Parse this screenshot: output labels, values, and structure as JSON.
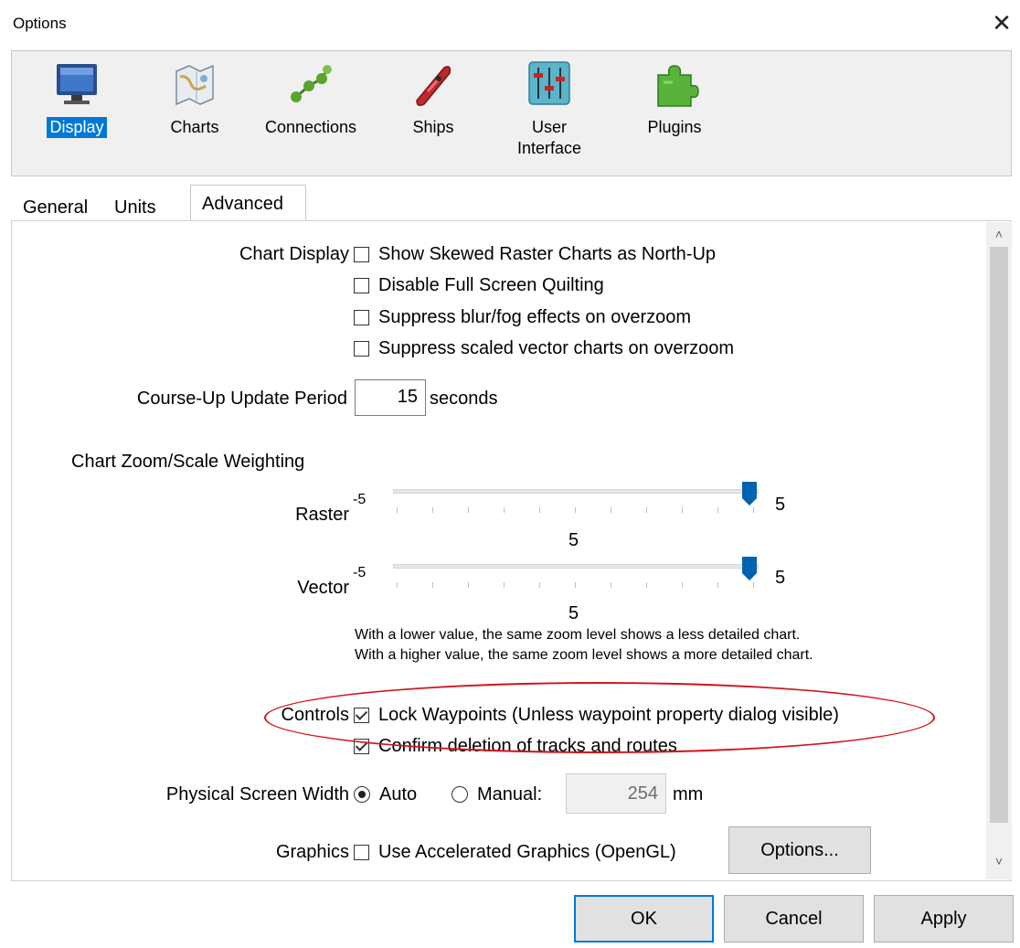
{
  "window": {
    "title": "Options",
    "close_glyph": "✕"
  },
  "toolbar": {
    "items": [
      {
        "label": "Display",
        "icon": "monitor-icon",
        "selected": true
      },
      {
        "label": "Charts",
        "icon": "chart-map-icon",
        "selected": false
      },
      {
        "label": "Connections",
        "icon": "connections-icon",
        "selected": false
      },
      {
        "label": "Ships",
        "icon": "ship-icon",
        "selected": false
      },
      {
        "label": "User\nInterface",
        "icon": "sliders-icon",
        "selected": false
      },
      {
        "label": "Plugins",
        "icon": "puzzle-icon",
        "selected": false
      }
    ]
  },
  "tabs": [
    {
      "label": "General",
      "active": false
    },
    {
      "label": "Units",
      "active": false
    },
    {
      "label": "Advanced",
      "active": true
    }
  ],
  "chart_display": {
    "label": "Chart Display",
    "options": [
      {
        "label": "Show Skewed Raster Charts as North-Up",
        "checked": false
      },
      {
        "label": "Disable Full Screen Quilting",
        "checked": false
      },
      {
        "label": "Suppress blur/fog effects on overzoom",
        "checked": false
      },
      {
        "label": "Suppress scaled vector charts on overzoom",
        "checked": false
      }
    ]
  },
  "course_up": {
    "label": "Course-Up Update Period",
    "value": "15",
    "unit": "seconds"
  },
  "zoom_weighting": {
    "heading": "Chart Zoom/Scale Weighting",
    "raster": {
      "label": "Raster",
      "min": "-5",
      "max": "5",
      "value": "5",
      "fraction": 1.0
    },
    "vector": {
      "label": "Vector",
      "min": "-5",
      "max": "5",
      "value": "5",
      "fraction": 1.0
    },
    "help_line1": "With a lower value, the same zoom level shows a less detailed chart.",
    "help_line2": "With a higher value, the same zoom level shows a more detailed chart."
  },
  "controls": {
    "label": "Controls",
    "options": [
      {
        "label": "Lock Waypoints (Unless waypoint property dialog visible)",
        "checked": true
      },
      {
        "label": "Confirm deletion of tracks and routes",
        "checked": true
      }
    ]
  },
  "screen_width": {
    "label": "Physical Screen Width",
    "auto_label": "Auto",
    "manual_label": "Manual:",
    "selected": "auto",
    "value": "254",
    "unit": "mm"
  },
  "graphics": {
    "label": "Graphics",
    "opengl_label": "Use Accelerated Graphics (OpenGL)",
    "opengl_checked": false,
    "options_button": "Options..."
  },
  "buttons": {
    "ok": "OK",
    "cancel": "Cancel",
    "apply": "Apply"
  },
  "colors": {
    "accent": "#0078d7",
    "highlight_oval": "#d0141c",
    "slider_thumb": "#0063b1"
  }
}
